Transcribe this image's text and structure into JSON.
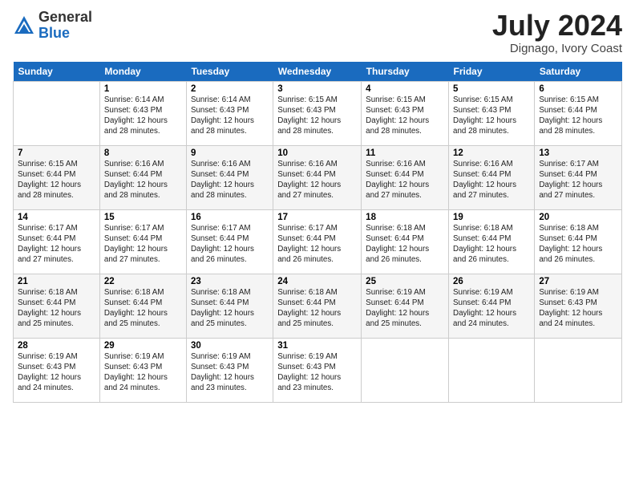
{
  "header": {
    "logo_general": "General",
    "logo_blue": "Blue",
    "month_year": "July 2024",
    "location": "Dignago, Ivory Coast"
  },
  "days_of_week": [
    "Sunday",
    "Monday",
    "Tuesday",
    "Wednesday",
    "Thursday",
    "Friday",
    "Saturday"
  ],
  "weeks": [
    [
      {
        "day": "",
        "info": ""
      },
      {
        "day": "1",
        "info": "Sunrise: 6:14 AM\nSunset: 6:43 PM\nDaylight: 12 hours\nand 28 minutes."
      },
      {
        "day": "2",
        "info": "Sunrise: 6:14 AM\nSunset: 6:43 PM\nDaylight: 12 hours\nand 28 minutes."
      },
      {
        "day": "3",
        "info": "Sunrise: 6:15 AM\nSunset: 6:43 PM\nDaylight: 12 hours\nand 28 minutes."
      },
      {
        "day": "4",
        "info": "Sunrise: 6:15 AM\nSunset: 6:43 PM\nDaylight: 12 hours\nand 28 minutes."
      },
      {
        "day": "5",
        "info": "Sunrise: 6:15 AM\nSunset: 6:43 PM\nDaylight: 12 hours\nand 28 minutes."
      },
      {
        "day": "6",
        "info": "Sunrise: 6:15 AM\nSunset: 6:44 PM\nDaylight: 12 hours\nand 28 minutes."
      }
    ],
    [
      {
        "day": "7",
        "info": "Sunrise: 6:15 AM\nSunset: 6:44 PM\nDaylight: 12 hours\nand 28 minutes."
      },
      {
        "day": "8",
        "info": "Sunrise: 6:16 AM\nSunset: 6:44 PM\nDaylight: 12 hours\nand 28 minutes."
      },
      {
        "day": "9",
        "info": "Sunrise: 6:16 AM\nSunset: 6:44 PM\nDaylight: 12 hours\nand 28 minutes."
      },
      {
        "day": "10",
        "info": "Sunrise: 6:16 AM\nSunset: 6:44 PM\nDaylight: 12 hours\nand 27 minutes."
      },
      {
        "day": "11",
        "info": "Sunrise: 6:16 AM\nSunset: 6:44 PM\nDaylight: 12 hours\nand 27 minutes."
      },
      {
        "day": "12",
        "info": "Sunrise: 6:16 AM\nSunset: 6:44 PM\nDaylight: 12 hours\nand 27 minutes."
      },
      {
        "day": "13",
        "info": "Sunrise: 6:17 AM\nSunset: 6:44 PM\nDaylight: 12 hours\nand 27 minutes."
      }
    ],
    [
      {
        "day": "14",
        "info": "Sunrise: 6:17 AM\nSunset: 6:44 PM\nDaylight: 12 hours\nand 27 minutes."
      },
      {
        "day": "15",
        "info": "Sunrise: 6:17 AM\nSunset: 6:44 PM\nDaylight: 12 hours\nand 27 minutes."
      },
      {
        "day": "16",
        "info": "Sunrise: 6:17 AM\nSunset: 6:44 PM\nDaylight: 12 hours\nand 26 minutes."
      },
      {
        "day": "17",
        "info": "Sunrise: 6:17 AM\nSunset: 6:44 PM\nDaylight: 12 hours\nand 26 minutes."
      },
      {
        "day": "18",
        "info": "Sunrise: 6:18 AM\nSunset: 6:44 PM\nDaylight: 12 hours\nand 26 minutes."
      },
      {
        "day": "19",
        "info": "Sunrise: 6:18 AM\nSunset: 6:44 PM\nDaylight: 12 hours\nand 26 minutes."
      },
      {
        "day": "20",
        "info": "Sunrise: 6:18 AM\nSunset: 6:44 PM\nDaylight: 12 hours\nand 26 minutes."
      }
    ],
    [
      {
        "day": "21",
        "info": "Sunrise: 6:18 AM\nSunset: 6:44 PM\nDaylight: 12 hours\nand 25 minutes."
      },
      {
        "day": "22",
        "info": "Sunrise: 6:18 AM\nSunset: 6:44 PM\nDaylight: 12 hours\nand 25 minutes."
      },
      {
        "day": "23",
        "info": "Sunrise: 6:18 AM\nSunset: 6:44 PM\nDaylight: 12 hours\nand 25 minutes."
      },
      {
        "day": "24",
        "info": "Sunrise: 6:18 AM\nSunset: 6:44 PM\nDaylight: 12 hours\nand 25 minutes."
      },
      {
        "day": "25",
        "info": "Sunrise: 6:19 AM\nSunset: 6:44 PM\nDaylight: 12 hours\nand 25 minutes."
      },
      {
        "day": "26",
        "info": "Sunrise: 6:19 AM\nSunset: 6:44 PM\nDaylight: 12 hours\nand 24 minutes."
      },
      {
        "day": "27",
        "info": "Sunrise: 6:19 AM\nSunset: 6:43 PM\nDaylight: 12 hours\nand 24 minutes."
      }
    ],
    [
      {
        "day": "28",
        "info": "Sunrise: 6:19 AM\nSunset: 6:43 PM\nDaylight: 12 hours\nand 24 minutes."
      },
      {
        "day": "29",
        "info": "Sunrise: 6:19 AM\nSunset: 6:43 PM\nDaylight: 12 hours\nand 24 minutes."
      },
      {
        "day": "30",
        "info": "Sunrise: 6:19 AM\nSunset: 6:43 PM\nDaylight: 12 hours\nand 23 minutes."
      },
      {
        "day": "31",
        "info": "Sunrise: 6:19 AM\nSunset: 6:43 PM\nDaylight: 12 hours\nand 23 minutes."
      },
      {
        "day": "",
        "info": ""
      },
      {
        "day": "",
        "info": ""
      },
      {
        "day": "",
        "info": ""
      }
    ]
  ]
}
